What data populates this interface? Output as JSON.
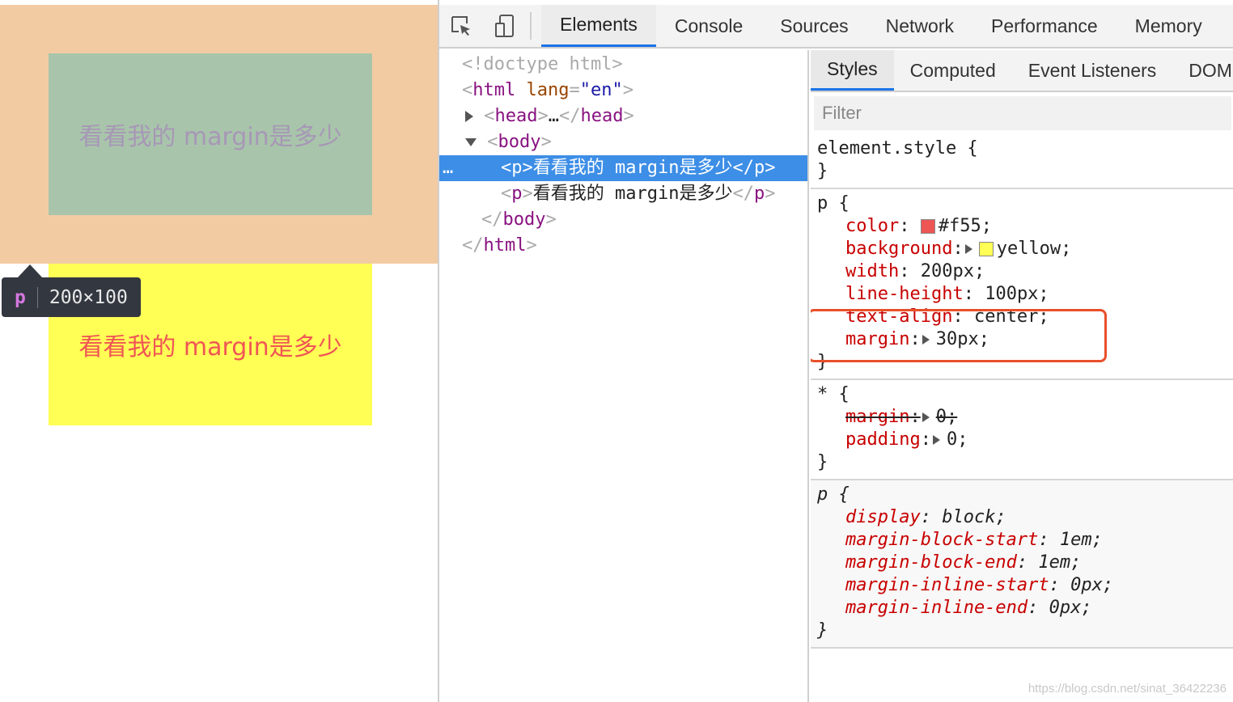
{
  "viewport": {
    "paragraph_text": "看看我的 margin是多少",
    "tooltip": {
      "tag": "p",
      "dimensions": "200×100"
    }
  },
  "devtools": {
    "tabs": [
      "Elements",
      "Console",
      "Sources",
      "Network",
      "Performance",
      "Memory"
    ],
    "active_tab": "Elements",
    "tree": {
      "doctype": "<!doctype html>",
      "html_tag": "html",
      "html_attr_name": "lang",
      "html_attr_value": "\"en\"",
      "head_tag": "head",
      "head_ellipsis": "…",
      "body_tag": "body",
      "p_tag": "p",
      "p_text": "看看我的 margin是多少",
      "selected_marker": "…"
    },
    "styles_pane": {
      "sub_tabs": [
        "Styles",
        "Computed",
        "Event Listeners",
        "DOM"
      ],
      "active_sub_tab": "Styles",
      "filter_placeholder": "Filter",
      "rules": {
        "element_style": {
          "selector": "element.style"
        },
        "p_rule": {
          "selector": "p",
          "declarations": [
            {
              "prop": "color",
              "value": "#f55;",
              "swatch": "#ee5555"
            },
            {
              "prop": "background",
              "value": "yellow;",
              "swatch": "#ffff55"
            },
            {
              "prop": "width",
              "value": "200px;"
            },
            {
              "prop": "line-height",
              "value": "100px;"
            },
            {
              "prop": "text-align",
              "value": "center;"
            },
            {
              "prop": "margin",
              "value": "30px;"
            }
          ]
        },
        "universal_rule": {
          "selector": "*",
          "declarations": [
            {
              "prop": "margin",
              "value": "0;",
              "struck": true
            },
            {
              "prop": "padding",
              "value": "0;"
            }
          ]
        },
        "ua_rule": {
          "selector": "p",
          "declarations": [
            {
              "prop": "display",
              "value": "block;"
            },
            {
              "prop": "margin-block-start",
              "value": "1em;"
            },
            {
              "prop": "margin-block-end",
              "value": "1em;"
            },
            {
              "prop": "margin-inline-start",
              "value": "0px;"
            },
            {
              "prop": "margin-inline-end",
              "value": "0px;"
            }
          ]
        }
      }
    }
  },
  "watermark": "https://blog.csdn.net/sinat_36422236",
  "colors": {
    "margin_overlay": "#f3cba3",
    "content_overlay": "#a8c5ab",
    "paragraph_bg": "#ffff55",
    "paragraph_text": "#f05555",
    "selection": "#3d8ee6",
    "annotation_box": "#e8502a"
  }
}
